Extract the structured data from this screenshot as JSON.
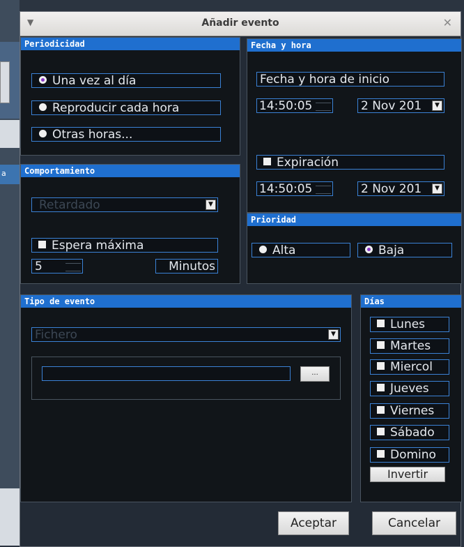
{
  "window": {
    "title": "Añadir evento",
    "menu_icon": "chevron-down-icon",
    "close_icon": "close-icon",
    "close_glyph": "✕"
  },
  "periodicity": {
    "header": "Periodicidad",
    "options": [
      {
        "label": "Una vez al día",
        "selected": true
      },
      {
        "label": "Reproducir cada hora",
        "selected": false
      },
      {
        "label": "Otras horas...",
        "selected": false
      }
    ]
  },
  "datetime": {
    "header": "Fecha y hora",
    "start_label": "Fecha y hora de inicio",
    "start_time": "14:50:05",
    "start_date": "2 Nov 201",
    "expiration_label": "Expiración",
    "expiration_checked": false,
    "expiration_time": "14:50:05",
    "expiration_date": "2 Nov 201"
  },
  "behavior": {
    "header": "Comportamiento",
    "mode_value": "Retardado",
    "max_wait_label": "Espera máxima",
    "max_wait_checked": false,
    "minutes_value": "5",
    "minutes_label": "Minutos"
  },
  "priority": {
    "header": "Prioridad",
    "options": [
      {
        "label": "Alta",
        "selected": false
      },
      {
        "label": "Baja",
        "selected": true
      }
    ]
  },
  "event_type": {
    "header": "Tipo de evento",
    "type_value": "Fichero",
    "path_value": "",
    "browse_label": "..."
  },
  "days": {
    "header": "Días",
    "items": [
      {
        "label": "Lunes",
        "checked": false
      },
      {
        "label": "Martes",
        "checked": false
      },
      {
        "label": "Miercol",
        "checked": false
      },
      {
        "label": "Jueves",
        "checked": false
      },
      {
        "label": "Viernes",
        "checked": false
      },
      {
        "label": "Sábado",
        "checked": false
      },
      {
        "label": "Domino",
        "checked": false
      }
    ],
    "invert_label": "Invertir"
  },
  "footer": {
    "accept_label": "Aceptar",
    "cancel_label": "Cancelar"
  },
  "colors": {
    "panel_header": "#1f6fcf",
    "field_border": "#3b82d6",
    "radio_selected": "#8a3ac6"
  }
}
